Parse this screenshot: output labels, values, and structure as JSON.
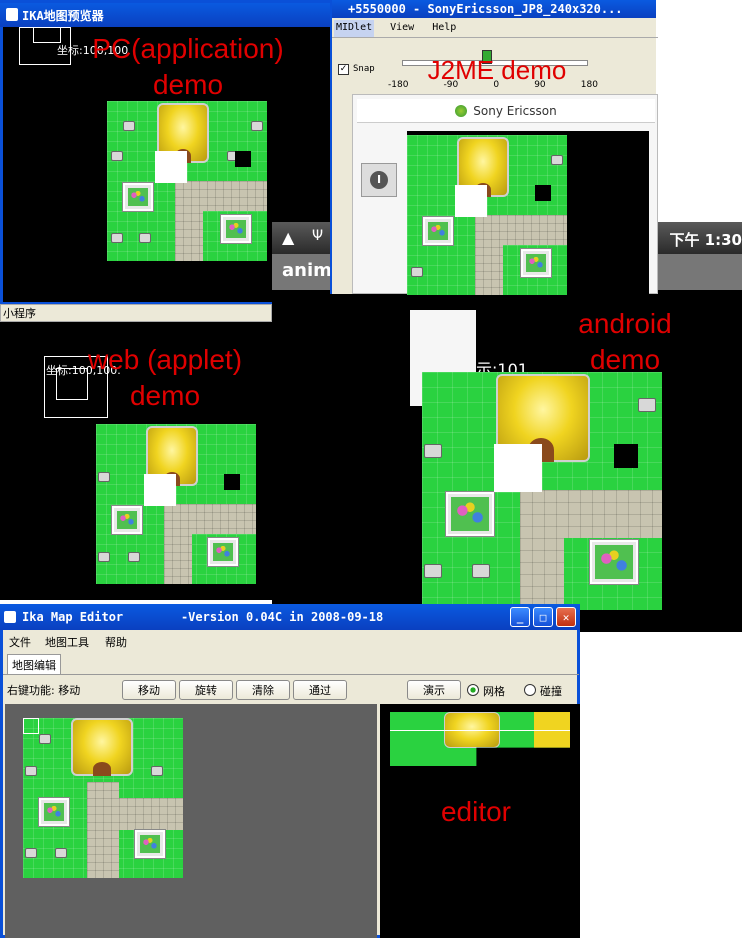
{
  "pc": {
    "title": "IKA地图预览器",
    "coords": "坐标:100,100",
    "label": "PC(application)\ndemo"
  },
  "j2me": {
    "title": "+5550000 - SonyEricsson_JP8_240x320...",
    "menu": [
      "MIDlet",
      "View",
      "Help"
    ],
    "snap": "Snap",
    "ticks": [
      "-180",
      "-90",
      "0",
      "90",
      "180"
    ],
    "brand": "Sony Ericsson",
    "label": "J2ME demo"
  },
  "android": {
    "status_time": "下午 1:30",
    "app_title": "anim",
    "coords": "示:101",
    "label": "android\ndemo"
  },
  "web": {
    "title": "小程序",
    "coords": "坐标:100,100.",
    "label": "web (applet)\ndemo"
  },
  "editor": {
    "title": "Ika Map Editor        -Version 0.04C in 2008-09-18",
    "menu": [
      "文件",
      "地图工具",
      "帮助"
    ],
    "tab": "地图编辑",
    "right_click_label": "右键功能: 移动",
    "buttons": [
      "移动",
      "旋转",
      "清除",
      "通过"
    ],
    "demo_button": "演示",
    "radio_grid": "网格",
    "radio_collision": "碰撞",
    "label": "editor"
  },
  "colors": {
    "grass": "#2ad240",
    "path": "#c8c4b0",
    "label_red": "#e00000",
    "xp_blue": "#0a5ae0"
  }
}
